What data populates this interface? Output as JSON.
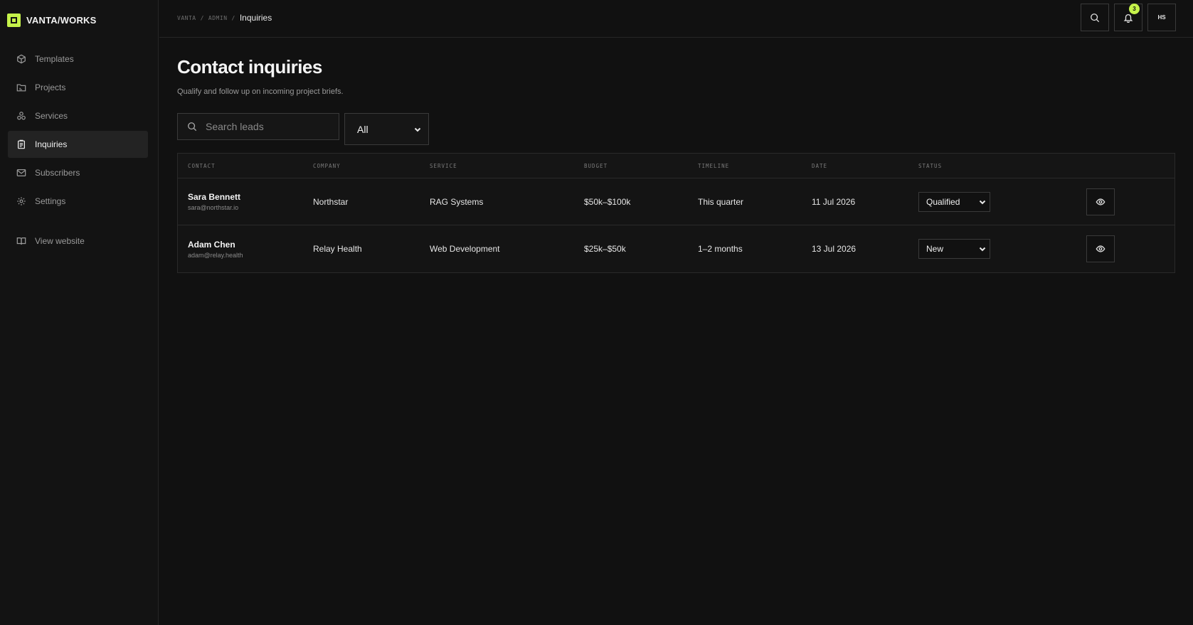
{
  "brand": {
    "name": "VANTA/WORKS",
    "accent_color": "#c5f24a"
  },
  "sidebar": {
    "items": [
      {
        "label": "Templates",
        "icon": "cube-icon",
        "active": false
      },
      {
        "label": "Projects",
        "icon": "folder-icon",
        "active": false
      },
      {
        "label": "Services",
        "icon": "services-icon",
        "active": false
      },
      {
        "label": "Inquiries",
        "icon": "clipboard-icon",
        "active": true
      },
      {
        "label": "Subscribers",
        "icon": "mail-icon",
        "active": false
      },
      {
        "label": "Settings",
        "icon": "gear-icon",
        "active": false
      }
    ],
    "view_website": {
      "label": "View website",
      "icon": "book-icon"
    }
  },
  "breadcrumb": {
    "root": "VANTA",
    "section": "ADMIN",
    "current": "Inquiries",
    "separator": "/"
  },
  "topbar": {
    "notification_count": "3",
    "avatar_initials": "HS"
  },
  "page": {
    "title": "Contact inquiries",
    "subtitle": "Qualify and follow up on incoming project briefs."
  },
  "filters": {
    "search_placeholder": "Search leads",
    "status_filter": "All"
  },
  "table": {
    "columns": {
      "contact": "CONTACT",
      "company": "COMPANY",
      "service": "SERVICE",
      "budget": "BUDGET",
      "timeline": "TIMELINE",
      "date": "DATE",
      "status": "STATUS"
    },
    "rows": [
      {
        "name": "Sara Bennett",
        "email": "sara@northstar.io",
        "company": "Northstar",
        "service": "RAG Systems",
        "budget": "$50k–$100k",
        "timeline": "This quarter",
        "date": "11 Jul 2026",
        "status": "Qualified"
      },
      {
        "name": "Adam Chen",
        "email": "adam@relay.health",
        "company": "Relay Health",
        "service": "Web Development",
        "budget": "$25k–$50k",
        "timeline": "1–2 months",
        "date": "13 Jul 2026",
        "status": "New"
      }
    ]
  }
}
